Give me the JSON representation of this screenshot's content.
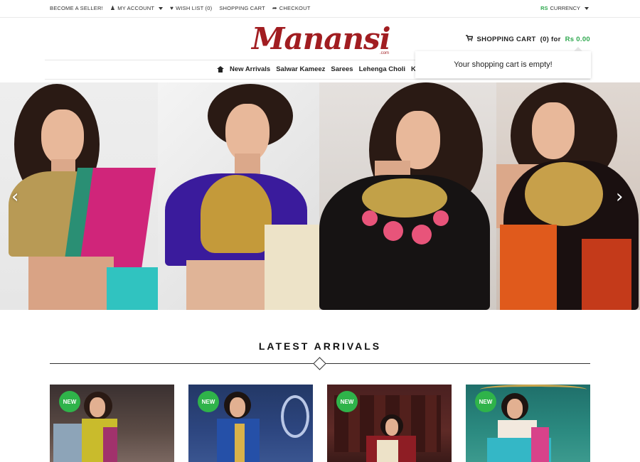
{
  "topbar": {
    "become_seller": "BECOME A SELLER!",
    "my_account": "MY ACCOUNT",
    "wish_list": "WISH LIST (0)",
    "shopping_cart": "SHOPPING CART",
    "checkout": "CHECKOUT",
    "currency_symbol": "RS",
    "currency_label": "CURRENCY"
  },
  "header": {
    "logo_text": "Manansi",
    "logo_sub": ".com",
    "cart_label": "SHOPPING CART",
    "cart_count": "(0) for",
    "cart_amount": "Rs 0.00",
    "cart_empty": "Your shopping cart is empty!"
  },
  "nav": {
    "items": [
      "New Arrivals",
      "Salwar Kameez",
      "Sarees",
      "Lehenga Choli",
      "Kur"
    ]
  },
  "slider": {
    "prev_icon": "chevron-left-icon",
    "next_icon": "chevron-right-icon"
  },
  "latest": {
    "title": "LATEST ARRIVALS",
    "badge": "NEW"
  },
  "colors": {
    "brand": "#a11d21",
    "accent": "#2fa84f",
    "badge": "#2fb34a"
  }
}
